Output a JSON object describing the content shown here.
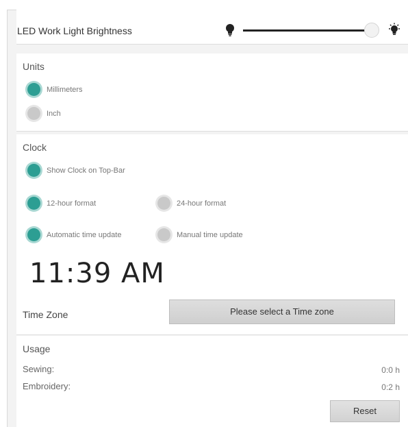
{
  "led": {
    "title": "LED Work Light Brightness",
    "brightness_level": 1.0,
    "low_icon": "light-bulb-icon",
    "high_icon": "light-bulb-bright-icon"
  },
  "units": {
    "title": "Units",
    "options": [
      {
        "label": "Millimeters",
        "selected": true
      },
      {
        "label": "Inch",
        "selected": false
      }
    ]
  },
  "clock": {
    "title": "Clock",
    "show_clock_label": "Show Clock on Top-Bar",
    "show_clock_selected": true,
    "format_12h_label": "12-hour format",
    "format_12h_selected": true,
    "format_24h_label": "24-hour format",
    "format_24h_selected": false,
    "auto_update_label": "Automatic time update",
    "auto_update_selected": true,
    "manual_update_label": "Manual time update",
    "manual_update_selected": false,
    "time": "11:39 AM",
    "timezone_label": "Time Zone",
    "timezone_button": "Please select a Time zone"
  },
  "usage": {
    "title": "Usage",
    "rows": [
      {
        "label": "Sewing:",
        "value": "0:0 h"
      },
      {
        "label": "Embroidery:",
        "value": "0:2 h"
      }
    ],
    "reset_label": "Reset"
  },
  "colors": {
    "accent": "#2d9e93",
    "accent_ring": "#a9d8d3",
    "off": "#c9c9c9"
  }
}
